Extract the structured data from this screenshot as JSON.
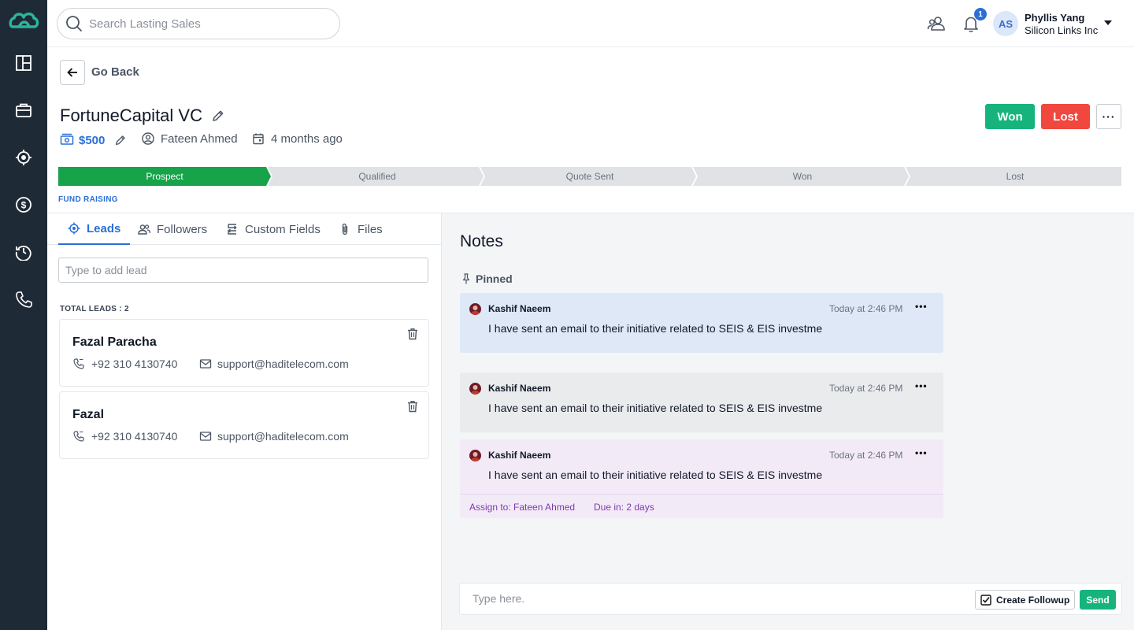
{
  "sidebar": {
    "logo": "brand-logo-icon",
    "items": [
      {
        "name": "dashboard",
        "icon": "grid-icon"
      },
      {
        "name": "deals",
        "icon": "briefcase-icon"
      },
      {
        "name": "leads",
        "icon": "target-icon"
      },
      {
        "name": "sales",
        "icon": "dollar-icon"
      },
      {
        "name": "activity",
        "icon": "history-icon"
      },
      {
        "name": "calls",
        "icon": "phone-icon"
      }
    ]
  },
  "header": {
    "search_placeholder": "Search Lasting Sales",
    "notification_count": "1",
    "user": {
      "initials": "AS",
      "name": "Phyllis Yang",
      "company": "Silicon Links Inc"
    }
  },
  "back": {
    "label": "Go Back"
  },
  "deal": {
    "title": "FortuneCapital VC",
    "amount": "$500",
    "owner": "Fateen Ahmed",
    "created": "4 months ago",
    "actions": {
      "won": "Won",
      "lost": "Lost",
      "more": "···"
    }
  },
  "pipeline": {
    "stages": [
      "Prospect",
      "Qualified",
      "Quote Sent",
      "Won",
      "Lost"
    ],
    "active_index": 0,
    "category": "FUND RAISING",
    "colors": {
      "active": "#16a34a",
      "inactive": "#e0e2e6"
    }
  },
  "tabs": [
    {
      "label": "Leads",
      "icon": "target-icon",
      "active": true
    },
    {
      "label": "Followers",
      "icon": "users-icon",
      "active": false
    },
    {
      "label": "Custom Fields",
      "icon": "fields-icon",
      "active": false
    },
    {
      "label": "Files",
      "icon": "paperclip-icon",
      "active": false
    }
  ],
  "leads": {
    "input_placeholder": "Type to add lead",
    "total_label": "TOTAL LEADS : 2",
    "items": [
      {
        "name": "Fazal Paracha",
        "phone": "+92 310 4130740",
        "email": "support@haditelecom.com"
      },
      {
        "name": "Fazal",
        "phone": "+92 310 4130740",
        "email": "support@haditelecom.com"
      }
    ]
  },
  "notes": {
    "title": "Notes",
    "pinned_label": "Pinned",
    "items": [
      {
        "author": "Kashif Naeem",
        "time": "Today at 2:46 PM",
        "text": "I have sent an email to their initiative related to SEIS & EIS investme",
        "color": "#dfe8f7"
      },
      {
        "author": "Kashif Naeem",
        "time": "Today at 2:46 PM",
        "text": "I have sent an email to their initiative related to SEIS & EIS investme",
        "color": "#eaebed"
      },
      {
        "author": "Kashif Naeem",
        "time": "Today at 2:46 PM",
        "text": "I have sent an email to their initiative related to SEIS & EIS investme",
        "color": "#f3eaf7",
        "assign": "Assign to: Fateen Ahmed",
        "due": "Due in: 2 days"
      }
    ],
    "composer_placeholder": "Type here.",
    "followup_label": "Create Followup",
    "followup_checked": true,
    "send_label": "Send"
  },
  "colors": {
    "accent": "#2b6fd6",
    "won": "#16b47c",
    "lost": "#f0473e",
    "sidebar": "#1f2a37",
    "brand": "#2bb59a"
  }
}
